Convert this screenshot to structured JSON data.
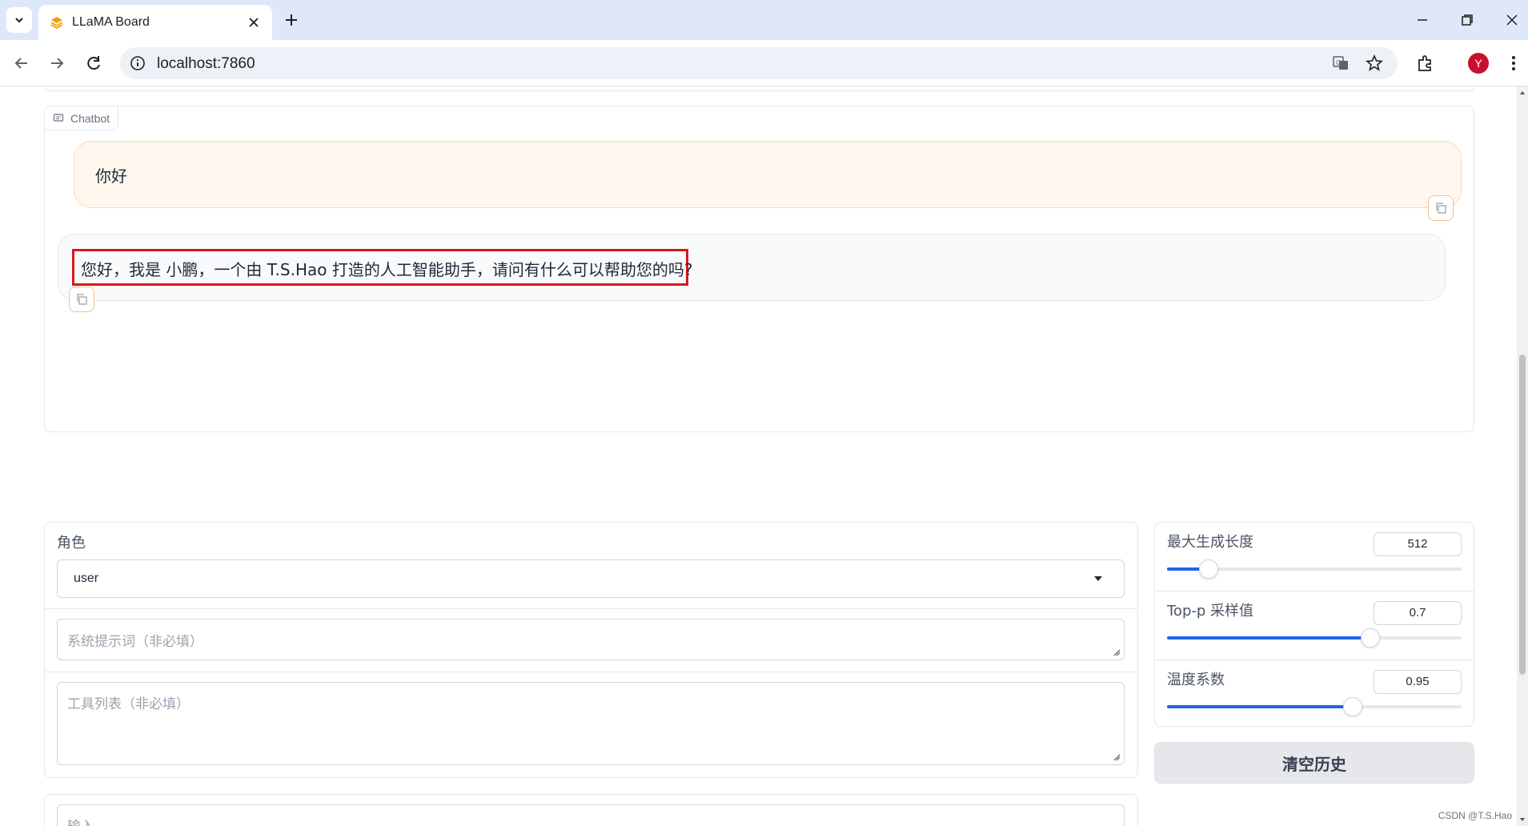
{
  "browser": {
    "tab_title": "LLaMA Board",
    "url": "localhost:7860",
    "profile_initial": "Y"
  },
  "chatbot": {
    "label": "Chatbot",
    "messages": [
      {
        "role": "user",
        "text": "你好"
      },
      {
        "role": "assistant",
        "text": "您好，我是 小鹏，一个由 T.S.Hao 打造的人工智能助手，请问有什么可以帮助您的吗?"
      }
    ]
  },
  "form": {
    "role_label": "角色",
    "role_value": "user",
    "system_prompt_placeholder": "系统提示词（非必填）",
    "tools_placeholder": "工具列表（非必填）",
    "input_placeholder": "输入..."
  },
  "params": [
    {
      "label": "最大生成长度",
      "value": "512",
      "fraction": 0.14
    },
    {
      "label": "Top-p 采样值",
      "value": "0.7",
      "fraction": 0.69
    },
    {
      "label": "温度系数",
      "value": "0.95",
      "fraction": 0.63
    }
  ],
  "clear_button": "清空历史",
  "watermark": "CSDN @T.S.Hao",
  "colors": {
    "accent": "#2563eb",
    "user_bubble": "#fff7ed",
    "highlight_box": "#d7191c"
  }
}
